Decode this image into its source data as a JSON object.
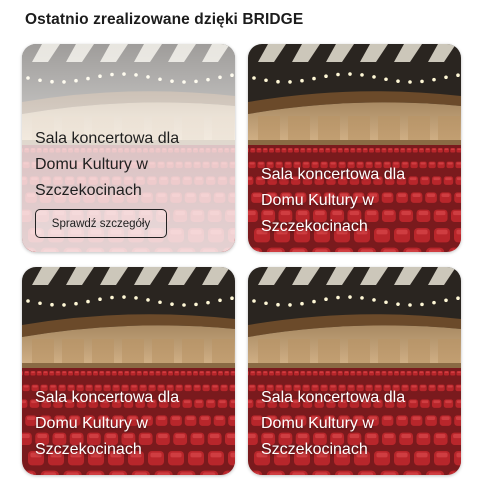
{
  "section": {
    "title": "Ostatnio zrealizowane dzięki BRIDGE"
  },
  "cards": [
    {
      "title": "Sala koncertowa dla Domu Kultury w Szczekocinach",
      "button_label": "Sprawdź szczegóły",
      "state": "hover"
    },
    {
      "title": "Sala koncertowa dla Domu Kultury w Szczekocinach",
      "state": "default"
    },
    {
      "title": "Sala koncertowa dla Domu Kultury w Szczekocinach",
      "state": "default"
    },
    {
      "title": "Sala koncertowa dla Domu Kultury w Szczekocinach",
      "state": "default"
    }
  ],
  "colors": {
    "title_text": "#1c1c1c",
    "seat_red": "#b8262b",
    "ceiling": "#2a2520",
    "wall_beige": "#c9a77d"
  }
}
